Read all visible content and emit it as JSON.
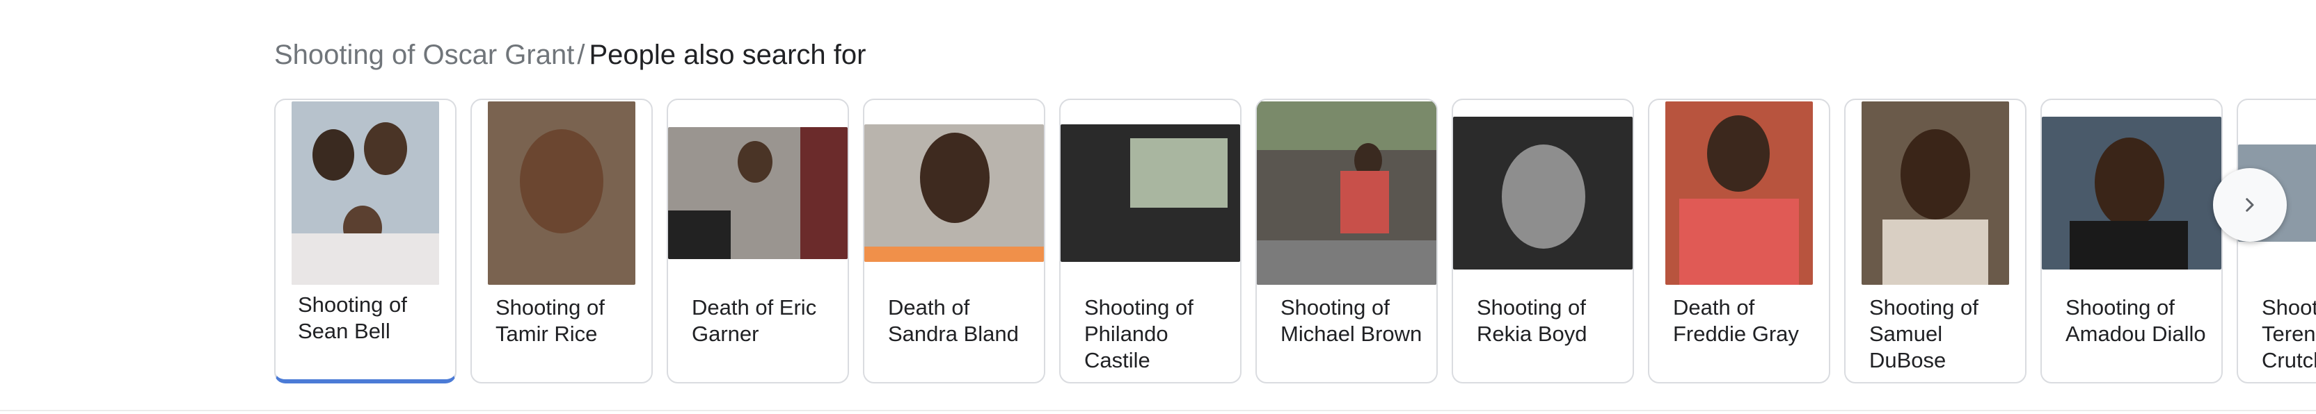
{
  "header": {
    "breadcrumb": "Shooting of Oscar Grant",
    "separator": "/",
    "title": "People also search for"
  },
  "accent_color": "#4b7bd6",
  "cards": [
    {
      "label": "Shooting of Sean Bell",
      "selected": true
    },
    {
      "label": "Shooting of Tamir Rice"
    },
    {
      "label": "Death of Eric Garner"
    },
    {
      "label": "Death of Sandra Bland"
    },
    {
      "label": "Shooting of Philando Castile"
    },
    {
      "label": "Shooting of Michael Brown"
    },
    {
      "label": "Shooting of Rekia Boyd"
    },
    {
      "label": "Death of Freddie Gray"
    },
    {
      "label": "Shooting of Samuel DuBose"
    },
    {
      "label": "Shooting of Amadou Diallo"
    },
    {
      "label": "Shooting of Terence Crutcher"
    }
  ],
  "next_button": {
    "icon": "chevron-right-icon"
  }
}
